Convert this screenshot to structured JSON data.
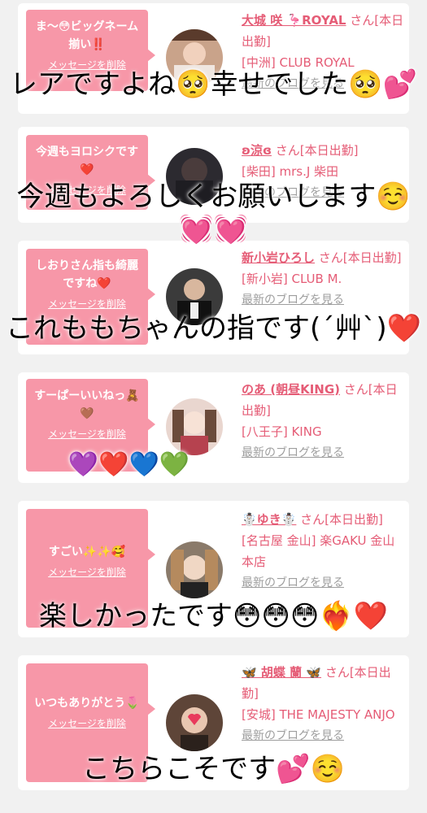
{
  "cards": [
    {
      "message": "ま〜😳ビッグネーム揃い‼️",
      "delete_label": "メッセージを削除",
      "name": "大城 咲 🦩ROYAL",
      "suffix": "さん[本日出勤]",
      "shop": "[中洲] CLUB ROYAL",
      "blog": "最新のブログを見る"
    },
    {
      "message": "今週もヨロシクです❤️",
      "delete_label": "メッセージを削除",
      "name": "ʚ涼ɞ",
      "suffix": "さん[本日出勤]",
      "shop": "[柴田] mrs.J 柴田",
      "blog": "最新のブログを見る"
    },
    {
      "message": "しおりさん指も綺麗ですね❤️",
      "delete_label": "メッセージを削除",
      "name": "新小岩ひろし",
      "suffix": "さん[本日出勤]",
      "shop": "[新小岩] CLUB M.",
      "blog": "最新のブログを見る"
    },
    {
      "message": "すーぱーいいねっ🧸🤎",
      "delete_label": "メッセージを削除",
      "name": "のあ (朝昼KING)",
      "suffix": "さん[本日出勤]",
      "shop": "[八王子] KING",
      "blog": "最新のブログを見る"
    },
    {
      "message": "すごい✨✨🥰",
      "delete_label": "メッセージを削除",
      "name": "☃️ゆき☃️",
      "suffix": "さん[本日出勤]",
      "shop": "[名古屋 金山] 楽GAKU 金山本店",
      "blog": "最新のブログを見る"
    },
    {
      "message": "いつもありがとう🌷",
      "delete_label": "メッセージを削除",
      "name": "🦋 胡蝶 蘭 🦋",
      "suffix": "さん[本日出勤]",
      "shop": "[安城] THE MAJESTY ANJO",
      "blog": "最新のブログを見る"
    }
  ],
  "overlays": [
    "レアですよね🥺幸せでした🥺💕",
    "今週もよろしくお願いします☺️💓💓",
    "これももちゃんの指です(´艸`)❤️",
    "💜❤️💙💚",
    "楽しかったです😳😳😳❤️‍🔥❤️",
    "こちらこそです💕☺️"
  ],
  "colors": {
    "accent": "#f797a8",
    "link": "#e55c76",
    "background": "#f1f1f1"
  },
  "icons": [
    "avatar-photo"
  ]
}
